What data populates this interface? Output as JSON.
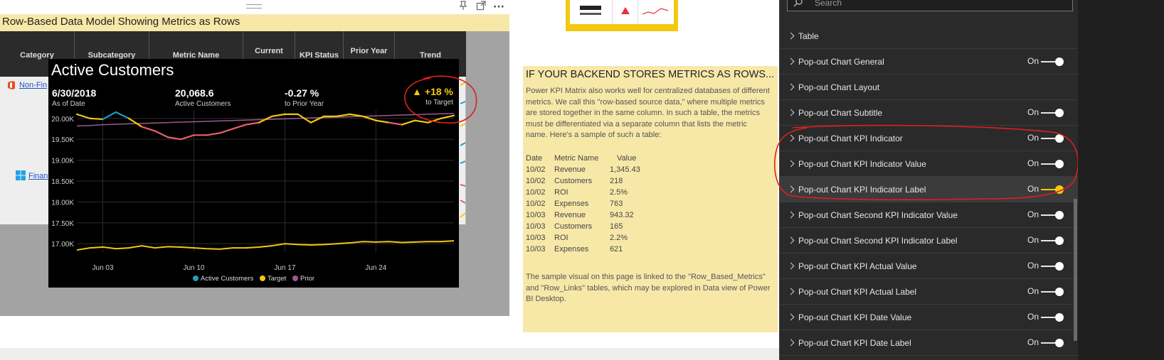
{
  "visual": {
    "title": "Row-Based Data Model Showing Metrics as Rows",
    "columns": [
      "Category",
      "Subcategory",
      "Metric Name",
      "Current",
      "KPI Status",
      "Prior Year",
      "Trend"
    ],
    "row_links": [
      "Non-Fin",
      "Finan"
    ]
  },
  "popout": {
    "title": "Active Customers",
    "kpis": [
      {
        "value": "6/30/2018",
        "label": "As of Date"
      },
      {
        "value": "20,068.6",
        "label": "Active Customers"
      },
      {
        "value": "-0.27 %",
        "label": "to Prior Year"
      }
    ],
    "indicator": {
      "value": "+18 %",
      "label": "to Target",
      "color": "#f2c811"
    },
    "legend": [
      {
        "name": "Active Customers",
        "color": "#1f9fbf"
      },
      {
        "name": "Target",
        "color": "#f2c811"
      },
      {
        "name": "Prior",
        "color": "#9c5a8c"
      }
    ]
  },
  "chart_data": {
    "type": "line",
    "y_ticks": [
      "20.00K",
      "19.50K",
      "19.00K",
      "18.50K",
      "18.00K",
      "17.50K",
      "17.00K"
    ],
    "x_ticks": [
      "Jun 03",
      "Jun 10",
      "Jun 17",
      "Jun 24"
    ],
    "ylim": [
      16.8,
      20.2
    ],
    "x": [
      1,
      2,
      3,
      4,
      5,
      6,
      7,
      8,
      9,
      10,
      11,
      12,
      13,
      14,
      15,
      16,
      17,
      18,
      19,
      20,
      21,
      22,
      23,
      24,
      25,
      26,
      27,
      28,
      29,
      30
    ],
    "series": [
      {
        "name": "Active Customers",
        "values": [
          20.1,
          20.0,
          19.98,
          20.15,
          20.0,
          19.8,
          19.7,
          19.55,
          19.5,
          19.6,
          19.6,
          19.65,
          19.75,
          19.85,
          19.9,
          20.05,
          20.1,
          20.1,
          19.9,
          20.05,
          20.05,
          20.1,
          20.05,
          19.95,
          19.9,
          19.85,
          19.95,
          19.9,
          20.0,
          20.07
        ],
        "color": "#f2c811",
        "alt_color": "#e8606a"
      },
      {
        "name": "Target",
        "values": [
          16.85,
          16.9,
          16.92,
          16.88,
          16.9,
          16.95,
          16.9,
          16.93,
          16.92,
          16.9,
          16.88,
          16.87,
          16.9,
          16.9,
          16.92,
          16.95,
          17.0,
          16.98,
          16.97,
          16.98,
          17.0,
          17.02,
          17.05,
          17.04,
          17.05,
          17.03,
          17.04,
          17.05,
          17.05,
          17.07
        ],
        "color": "#f2c811"
      },
      {
        "name": "Prior",
        "values": [
          19.82,
          19.83,
          19.85,
          19.86,
          19.87,
          19.88,
          19.89,
          19.9,
          19.91,
          19.92,
          19.93,
          19.94,
          19.95,
          19.96,
          19.97,
          19.98,
          19.99,
          20.0,
          20.01,
          20.02,
          20.03,
          20.04,
          20.05,
          20.06,
          20.07,
          20.08,
          20.09,
          20.1,
          20.11,
          20.12
        ],
        "color": "#9c5a8c"
      }
    ]
  },
  "info": {
    "title": "IF YOUR BACKEND STORES METRICS AS ROWS...",
    "paragraph_lines": [
      "Power KPI Matrix also works well for centralized databases of different",
      "metrics.  We call this \"row-based source data,\" where multiple metrics",
      "are stored together in the same column. In such a table, the metrics",
      "must be differentiated via a separate column that lists the metric",
      "name.  Here's a sample of such a table:"
    ],
    "table_header": [
      "Date",
      "Metric Name",
      "Value"
    ],
    "table_rows": [
      [
        "10/02",
        "Revenue",
        "1,345.43"
      ],
      [
        "10/02",
        "Customers",
        "218"
      ],
      [
        "10/02",
        "ROI",
        "2.5%"
      ],
      [
        "10/02",
        "Expenses",
        "763"
      ],
      [
        "10/03",
        "Revenue",
        "943.32"
      ],
      [
        "10/03",
        "Customers",
        "165"
      ],
      [
        "10/03",
        "ROI",
        "2.2%"
      ],
      [
        "10/03",
        "Expenses",
        "621"
      ]
    ],
    "footer_lines": [
      "The sample visual on this page is linked to the \"Row_Based_Metrics\"",
      "and \"Row_Links\" tables, which may be explored in Data view of Power",
      "BI Desktop."
    ]
  },
  "format_pane": {
    "search_placeholder": "Search",
    "rows": [
      {
        "label": "Table",
        "state": ""
      },
      {
        "label": "Pop-out Chart General",
        "state": "On"
      },
      {
        "label": "Pop-out Chart Layout",
        "state": ""
      },
      {
        "label": "Pop-out Chart Subtitle",
        "state": "On"
      },
      {
        "label": "Pop-out Chart KPI Indicator",
        "state": "On"
      },
      {
        "label": "Pop-out Chart KPI Indicator Value",
        "state": "On"
      },
      {
        "label": "Pop-out Chart KPI Indicator Label",
        "state": "On"
      },
      {
        "label": "Pop-out Chart Second KPI Indicator Value",
        "state": "On"
      },
      {
        "label": "Pop-out Chart Second KPI Indicator Label",
        "state": "On"
      },
      {
        "label": "Pop-out Chart KPI Actual Value",
        "state": "On"
      },
      {
        "label": "Pop-out Chart KPI Actual Label",
        "state": "On"
      },
      {
        "label": "Pop-out Chart KPI Date Value",
        "state": "On"
      },
      {
        "label": "Pop-out Chart KPI Date Label",
        "state": "On"
      }
    ]
  }
}
